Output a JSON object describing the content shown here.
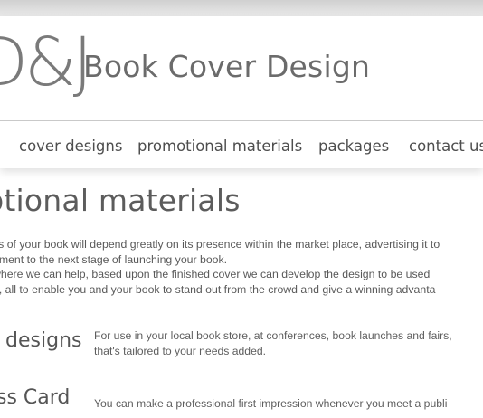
{
  "header": {
    "logo_mark": "D&J",
    "logo_name": "Book Cover Design"
  },
  "nav": {
    "items": [
      {
        "label": "cover designs"
      },
      {
        "label": "promotional materials"
      },
      {
        "label": "packages"
      },
      {
        "label": "contact us"
      }
    ]
  },
  "main": {
    "title": "otional materials",
    "intro_lines": [
      "ss of your book will depend greatly on its presence within the market place, advertising it to",
      "ement to the next stage of launching your book.",
      " where we can help, based upon the finished cover we can develop the design to be used",
      "g, all to enable you and your book to stand out from the crowd and give a winning advanta"
    ],
    "sections": [
      {
        "title": "r designs",
        "lines": [
          "For use in your local book store, at conferences, book launches and fairs,",
          "that's tailored to your needs added."
        ]
      },
      {
        "title": "ss Card",
        "lines": [
          "You can make a professional first impression whenever you meet a publi"
        ]
      }
    ]
  }
}
